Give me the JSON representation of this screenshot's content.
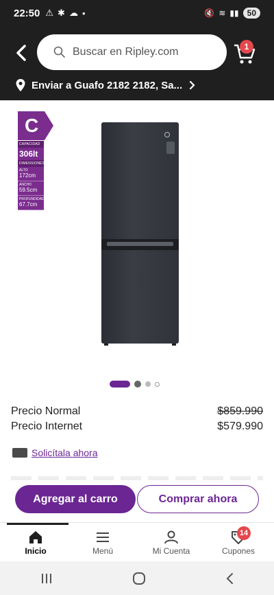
{
  "status_bar": {
    "time": "22:50",
    "battery": "50"
  },
  "header": {
    "search_placeholder": "Buscar en Ripley.com",
    "cart_count": "1",
    "shipping_text": "Enviar a Guafo 2182 2182, Sa..."
  },
  "energy_label": {
    "class_letter": "C",
    "capacity_label": "CAPACIDAD",
    "capacity_value": "306lt",
    "dimensions_label": "DIMENSIONES",
    "height_label": "ALTO",
    "height_value": "172cm",
    "width_label": "ANCHO",
    "width_value": "59.5cm",
    "depth_label": "PROFUNDIDAD",
    "depth_value": "67.7cm"
  },
  "product": {
    "brand_mark": "LG"
  },
  "pricing": {
    "normal_label": "Precio Normal",
    "normal_value": "$859.990",
    "internet_label": "Precio Internet",
    "internet_value": "$579.990"
  },
  "loan_link": "Solicítala ahora",
  "actions": {
    "add_to_cart": "Agregar al carro",
    "buy_now": "Comprar ahora"
  },
  "bottom_nav": {
    "items": [
      {
        "label": "Inicio",
        "icon": "home-icon"
      },
      {
        "label": "Menú",
        "icon": "menu-icon"
      },
      {
        "label": "Mi Cuenta",
        "icon": "user-icon"
      },
      {
        "label": "Cupones",
        "icon": "coupon-icon"
      }
    ],
    "coupon_count": "14"
  },
  "colors": {
    "brand_purple": "#6b2693",
    "header_bg": "#1f1f1f",
    "badge_red": "#e5484d"
  }
}
